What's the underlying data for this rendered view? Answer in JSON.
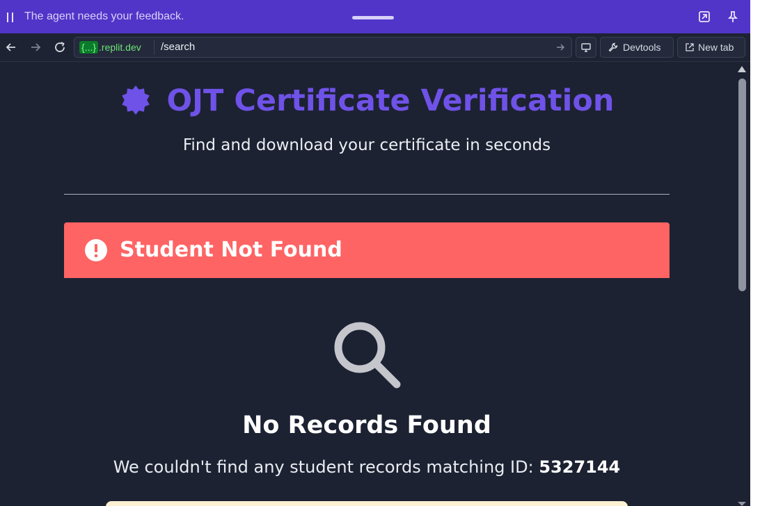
{
  "agent_bar": {
    "message": "The agent needs your feedback."
  },
  "browser": {
    "domain_brace": "{...}",
    "domain_suffix": ".replit.dev",
    "path": "/search",
    "devtools_label": "Devtools",
    "new_tab_label": "New tab"
  },
  "page": {
    "title": "OJT Certificate Verification",
    "subtitle": "Find and download your certificate in seconds",
    "alert_title": "Student Not Found",
    "no_records_title": "No Records Found",
    "no_records_message": "We couldn't find any student records matching ID:",
    "searched_id": "5327144"
  },
  "colors": {
    "agent_bar": "#5135c8",
    "accent": "#6f52e8",
    "alert": "#ff6464",
    "background": "#1c2232"
  },
  "icons": {
    "pause": "pause-icon",
    "open_external": "open-external-icon",
    "pin": "pin-icon",
    "back": "arrow-left-icon",
    "forward": "arrow-right-icon",
    "reload": "reload-icon",
    "go": "arrow-right-icon",
    "screen": "monitor-icon",
    "devtools": "wrench-icon",
    "new_tab": "external-link-icon",
    "title_badge": "certificate-badge-icon",
    "alert": "exclamation-circle-icon",
    "search": "search-icon"
  }
}
